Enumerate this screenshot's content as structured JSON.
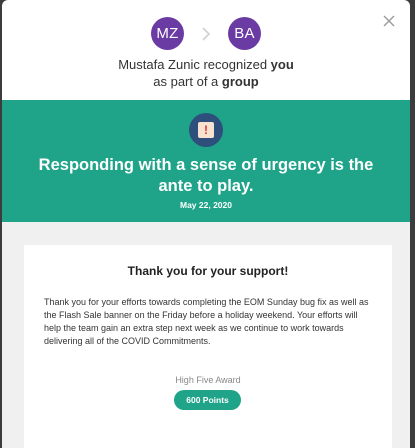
{
  "header": {
    "sender_initials": "MZ",
    "recipient_initials": "BA",
    "sender_name": "Mustafa Zunic",
    "text_recognized": " recognized ",
    "text_you": "you",
    "text_as_part": "as part of a ",
    "text_group": "group",
    "avatar_color": "#6a3ba3"
  },
  "value": {
    "icon": "exclamation-badge-icon",
    "title": "Responding with a sense of urgency is the ante to play.",
    "date": "May 22, 2020",
    "band_color": "#1fa489"
  },
  "card": {
    "title": "Thank you for your support!",
    "message": "Thank you for your efforts towards completing the EOM Sunday bug fix as well as the Flash Sale banner on the Friday before a holiday weekend. Your efforts will help the team gain an extra step next week as we continue to work towards delivering all of the COVID Commitments.",
    "award_name": "High Five Award",
    "points": "600 Points"
  },
  "controls": {
    "close_icon": "close-icon",
    "arrow_icon": "chevron-right-icon"
  }
}
